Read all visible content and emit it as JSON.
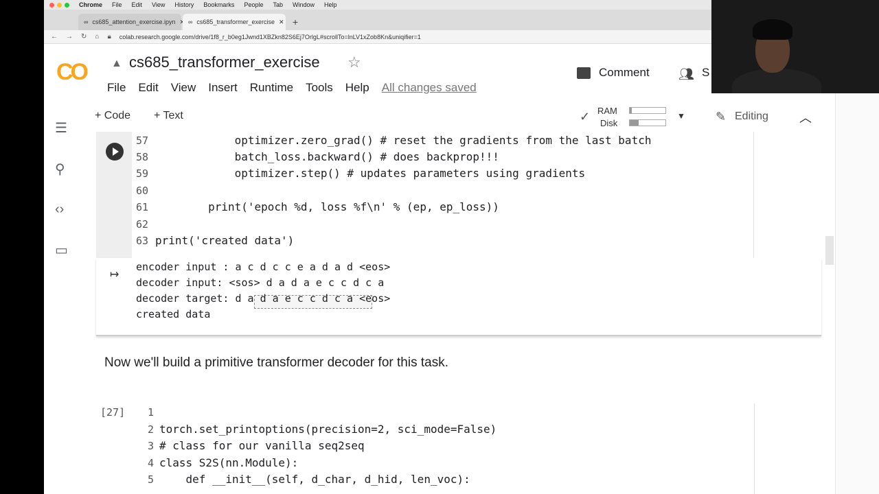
{
  "mac_menubar": {
    "items": [
      "Chrome",
      "File",
      "Edit",
      "View",
      "History",
      "Bookmarks",
      "People",
      "Tab",
      "Window",
      "Help"
    ]
  },
  "browser": {
    "tabs": [
      {
        "label": "cs685_attention_exercise.ipyn"
      },
      {
        "label": "cs685_transformer_exercise"
      }
    ],
    "new_tab": "+",
    "url": "colab.research.google.com/drive/1f8_r_b0eg1Jwnd1XBZkn82S6Ej7OrlgL#scrollTo=lnLV1xZob8Kn&uniqifier=1"
  },
  "colab": {
    "logo": "CO",
    "title": "cs685_transformer_exercise",
    "menu": [
      "File",
      "Edit",
      "View",
      "Insert",
      "Runtime",
      "Tools",
      "Help"
    ],
    "saved_status": "All changes saved",
    "comment_label": "Comment",
    "share_label": "S",
    "toolbar": {
      "add_code": "+ Code",
      "add_text": "+ Text",
      "ram_label": "RAM",
      "disk_label": "Disk",
      "ram_usage": 0.05,
      "disk_usage": 0.25,
      "editing_label": "Editing"
    }
  },
  "cell1": {
    "lines": [
      {
        "num": "57",
        "code": "            optimizer.zero_grad() # reset the gradients from the last batch"
      },
      {
        "num": "58",
        "code": "            batch_loss.backward() # does backprop!!!"
      },
      {
        "num": "59",
        "code": "            optimizer.step() # updates parameters using gradients"
      },
      {
        "num": "60",
        "code": ""
      },
      {
        "num": "61",
        "code": "        print('epoch %d, loss %f\\n' % (ep, ep_loss))"
      },
      {
        "num": "62",
        "code": ""
      },
      {
        "num": "63",
        "code": "print('created data')"
      }
    ],
    "output": [
      "encoder input : a c d c c e a d a d <eos>",
      "decoder input: <sos> d a d a e c c d c a",
      "decoder target: d a d a e c c d c a <eos>",
      "created data"
    ]
  },
  "text_cell": "Now we'll build a primitive transformer decoder for this task.",
  "cell2": {
    "exec_count": "[27]",
    "lines": [
      {
        "num": "1",
        "code": ""
      },
      {
        "num": "2",
        "code": "torch.set_printoptions(precision=2, sci_mode=False)"
      },
      {
        "num": "3",
        "code": "# class for our vanilla seq2seq"
      },
      {
        "num": "4",
        "code": "class S2S(nn.Module):"
      },
      {
        "num": "5",
        "code": "    def __init__(self, d_char, d_hid, len_voc):"
      }
    ]
  }
}
